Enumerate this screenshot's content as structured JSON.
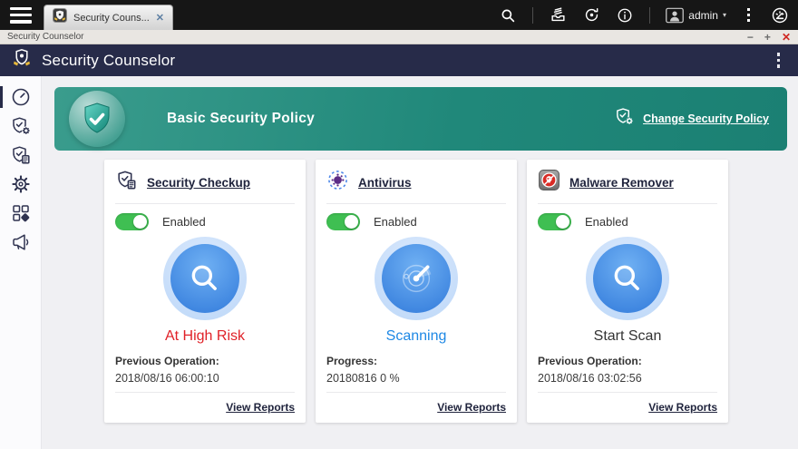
{
  "desktop_bar": {
    "tab": {
      "label": "Security Couns...",
      "close_glyph": "✕"
    },
    "admin_label": "admin",
    "admin_caret": "▾",
    "icons": [
      "search-icon",
      "file-station-icon",
      "background-tasks-icon",
      "info-icon",
      "user-avatar-icon",
      "more-options-icon",
      "resource-monitor-icon"
    ]
  },
  "window_bar": {
    "title": "Security Counselor",
    "minimize_glyph": "−",
    "maximize_glyph": "+",
    "close_glyph": "✕"
  },
  "app_header": {
    "title": "Security Counselor"
  },
  "sidebar": {
    "items": [
      "overview-gauge-icon",
      "security-checkup-shield-gear-icon",
      "security-report-shield-icon",
      "settings-gear-icon",
      "apps-grid-icon",
      "announcements-megaphone-icon"
    ],
    "active_index": 0
  },
  "banner": {
    "title": "Basic Security Policy",
    "change_link": "Change Security Policy",
    "icon": "shield-check-bubble-icon"
  },
  "cards": [
    {
      "title": "Security Checkup",
      "header_icon": "shield-check-report-icon",
      "toggle_label": "Enabled",
      "toggle_state": "on",
      "scan_icon": "magnifier",
      "status": "At High Risk",
      "status_color": "#e02128",
      "line1": "Previous Operation:",
      "line2": "2018/08/16 06:00:10",
      "link": "View Reports"
    },
    {
      "title": "Antivirus",
      "header_icon": "virus-icon",
      "toggle_label": "Enabled",
      "toggle_state": "on",
      "scan_icon": "radar",
      "status": "Scanning",
      "status_color": "#1e88e5",
      "line1": "Progress:",
      "line2": "20180816 0 %",
      "link": "View Reports"
    },
    {
      "title": "Malware Remover",
      "header_icon": "malware-skull-icon",
      "toggle_label": "Enabled",
      "toggle_state": "on",
      "scan_icon": "magnifier",
      "status": "Start Scan",
      "status_color": "#333333",
      "line1": "Previous Operation:",
      "line2": "2018/08/16 03:02:56",
      "link": "View Reports"
    }
  ],
  "colors": {
    "banner_teal": "#1f8578",
    "header_navy": "#272b49",
    "toggle_green": "#3fbf52",
    "scan_blue": "#3f86e0",
    "risk_red": "#e02128",
    "scanning_blue": "#1e88e5"
  }
}
